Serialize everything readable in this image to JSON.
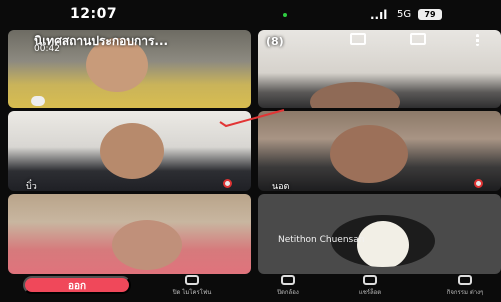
{
  "status_bar": {
    "time": "12:07",
    "signal": "..ıl",
    "network": "5G",
    "battery": "79"
  },
  "meeting": {
    "title": "นิเทศสถานประกอบการ...",
    "participant_count": "(8)",
    "duration": "00:42"
  },
  "header_icons": [
    "chat-icon",
    "camera-switch-icon",
    "more-icon"
  ],
  "tiles": [
    {
      "name": "",
      "muted": false
    },
    {
      "name": "",
      "muted": false
    },
    {
      "name": "บิ๋ว",
      "muted": true
    },
    {
      "name": "นอต",
      "muted": true
    },
    {
      "name": "",
      "muted": false
    },
    {
      "name": "Netithon Chuensan",
      "muted": false
    }
  ],
  "controls": {
    "leave": "ออก",
    "items": [
      {
        "label": "ปิด ไมโครโฟน",
        "icon": "microphone-icon"
      },
      {
        "label": "ปิดกล้อง",
        "icon": "camera-icon"
      },
      {
        "label": "แชร์ล็อต",
        "icon": "share-icon"
      },
      {
        "label": "กิจกรรม ต่างๆ",
        "icon": "activities-icon"
      }
    ]
  },
  "colors": {
    "leave_button": "#f0485a",
    "background": "#0b0b0b",
    "mic_off_badge": "#d33"
  }
}
